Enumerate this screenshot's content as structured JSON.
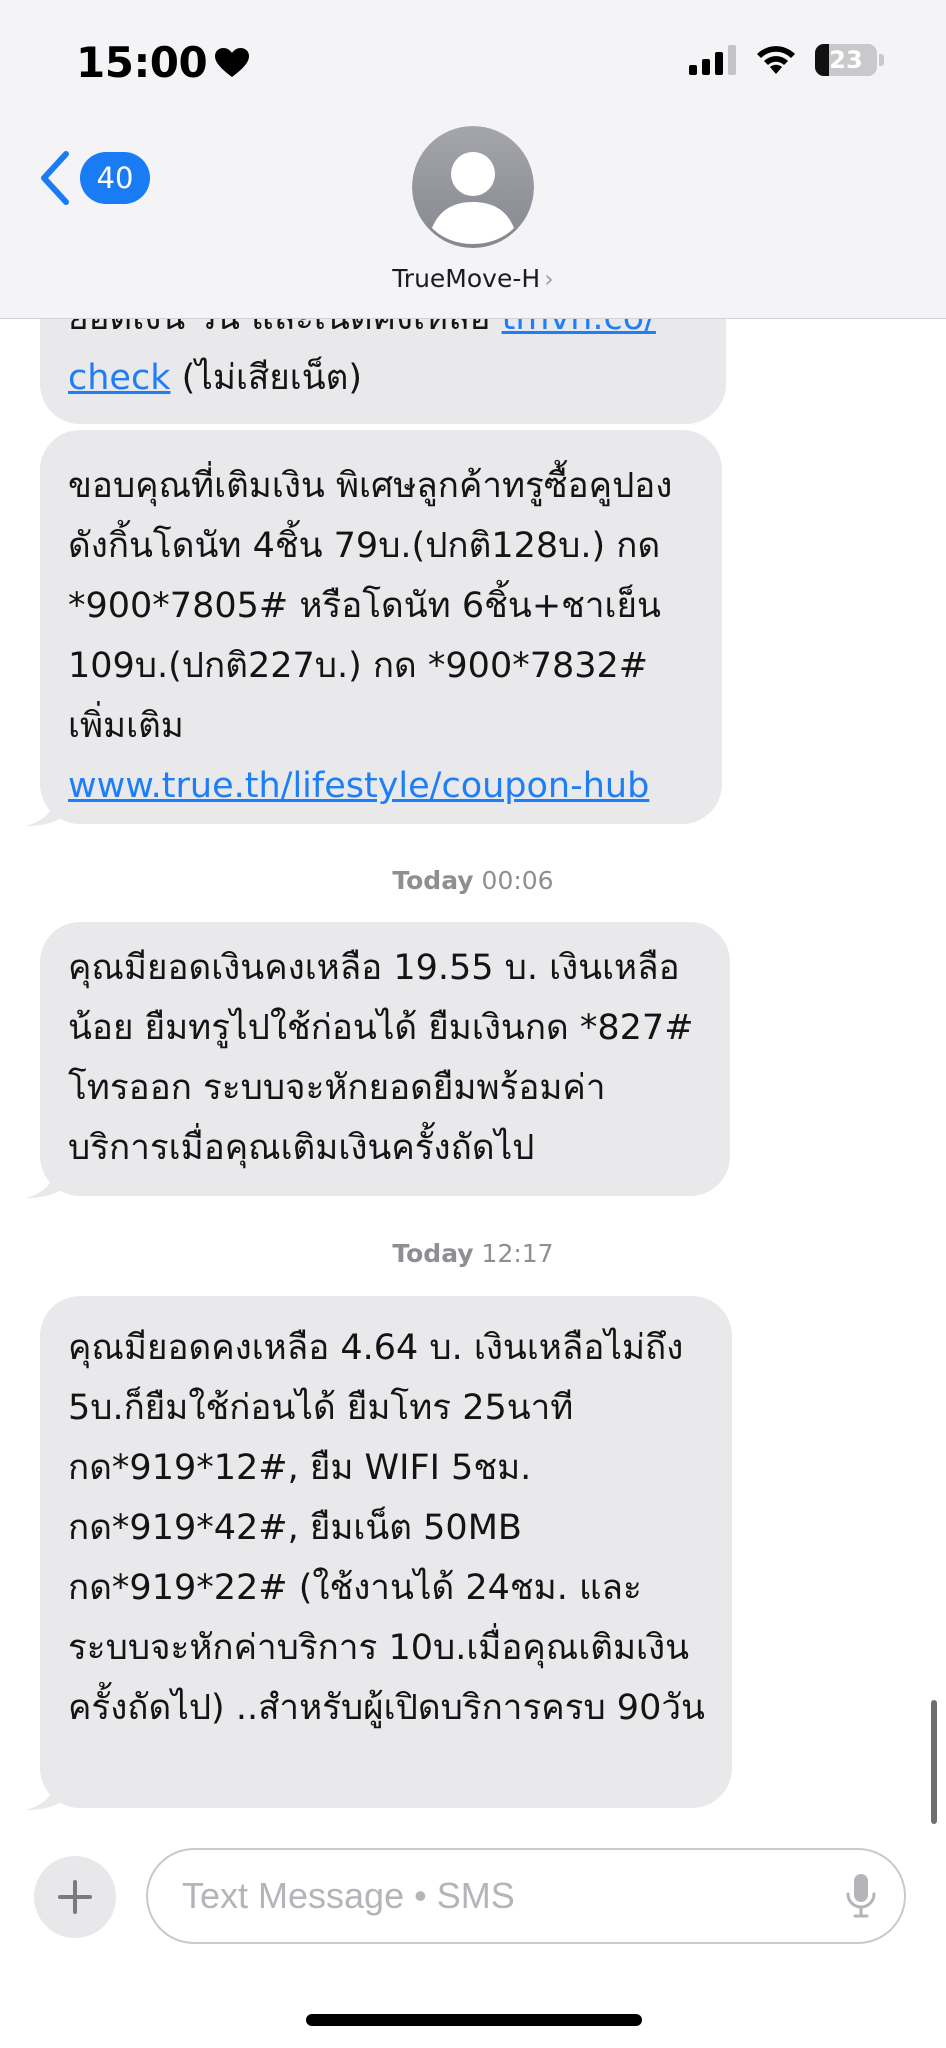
{
  "status_bar": {
    "time": "15:00",
    "battery_level": "23",
    "battery_fraction": 0.23,
    "icons": [
      "heart-icon",
      "signal-icon",
      "wifi-icon",
      "battery-icon"
    ]
  },
  "header": {
    "back_count": "40",
    "contact_name": "TrueMove-H",
    "chevron": "›"
  },
  "messages": [
    {
      "partial_line": "ยอดเงิน วัน และเน็ตคงเหลือ ",
      "partial_link": "tmvh.co/",
      "line2_link": "check",
      "line2_text": " (ไม่เสียเน็ต)"
    },
    {
      "text": "ขอบคุณที่เติมเงิน พิเศษลูกค้าทรูซื้อคูปอง ดังกิ้นโดนัท 4ชิ้น 79บ.(ปกติ128บ.) กด *900*7805# หรือโดนัท 6ชิ้น+ชาเย็น 109บ.(ปกติ227บ.) กด *900*7832# เพิ่มเติม",
      "link": "www.true.th/lifestyle/coupon-hub"
    },
    {
      "timestamp_day": "Today",
      "timestamp_time": "00:06",
      "text": "คุณมียอดเงินคงเหลือ 19.55 บ. เงินเหลือน้อย ยืมทรูไปใช้ก่อนได้ ยืมเงินกด *827# โทรออก ระบบจะหักยอดยืมพร้อมค่าบริการเมื่อคุณเติมเงินครั้งถัดไป"
    },
    {
      "timestamp_day": "Today",
      "timestamp_time": "12:17",
      "text": "คุณมียอดคงเหลือ 4.64 บ. เงินเหลือไม่ถึง 5บ.ก็ยืมใช้ก่อนได้ ยืมโทร 25นาที กด*919*12#, ยืม WIFI 5ชม. กด*919*42#, ยืมเน็ต 50MB กด*919*22# (ใช้งานได้ 24ชม. และระบบจะหักค่าบริการ 10บ.เมื่อคุณเติมเงินครั้งถัดไป) ..สำหรับผู้เปิดบริการครบ 90วัน"
    }
  ],
  "composer": {
    "placeholder": "Text Message • SMS"
  },
  "colors": {
    "accent": "#1a7cf5",
    "bubble": "#e9e9eb",
    "header_bg": "#f4f4f6"
  }
}
